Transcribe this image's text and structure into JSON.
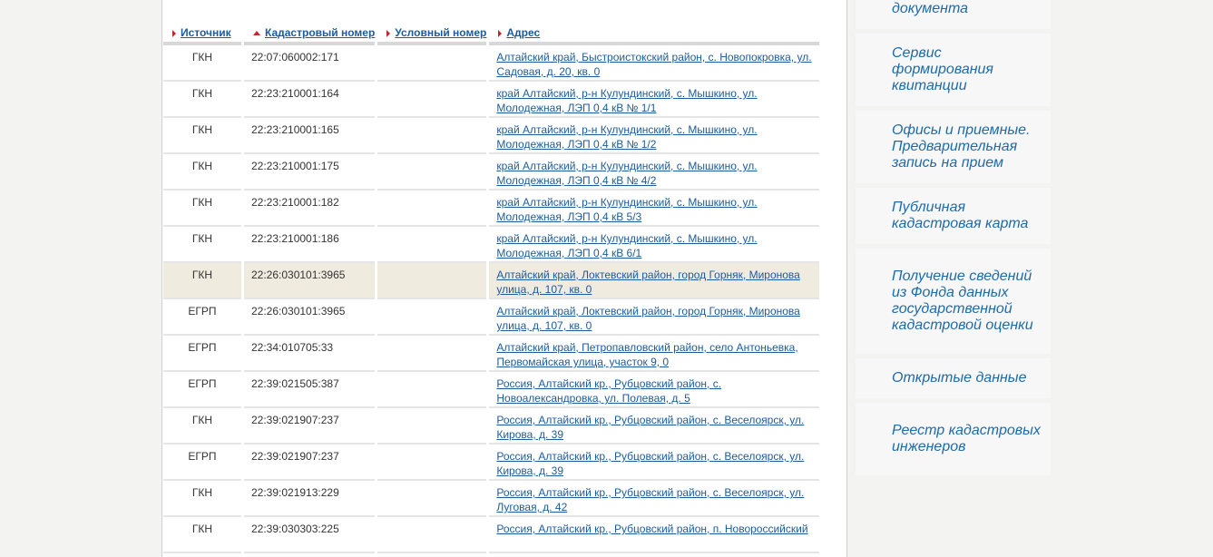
{
  "table": {
    "headers": [
      {
        "label": "Источник",
        "sort": "right"
      },
      {
        "label": "Кадастровый номер",
        "sort": "up"
      },
      {
        "label": "Условный номер",
        "sort": "right"
      },
      {
        "label": "Адрес",
        "sort": "right"
      }
    ],
    "rows": [
      {
        "source": "ГКН",
        "cadastral": "22:07:060002:171",
        "conditional": "",
        "address": "Алтайский край, Быстроистокский район, с. Новопокровка, ул. Садовая, д. 20, кв. 0"
      },
      {
        "source": "ГКН",
        "cadastral": "22:23:210001:164",
        "conditional": "",
        "address": "край Алтайский, р-н Кулундинский, с. Мышкино, ул. Молодежная, ЛЭП 0,4 кВ № 1/1"
      },
      {
        "source": "ГКН",
        "cadastral": "22:23:210001:165",
        "conditional": "",
        "address": "край Алтайский, р-н Кулундинский, с. Мышкино, ул. Молодежная, ЛЭП 0,4 кВ № 1/2"
      },
      {
        "source": "ГКН",
        "cadastral": "22:23:210001:175",
        "conditional": "",
        "address": "край Алтайский, р-н Кулундинский, с. Мышкино, ул. Молодежная, ЛЭП 0,4 кВ № 4/2"
      },
      {
        "source": "ГКН",
        "cadastral": "22:23:210001:182",
        "conditional": "",
        "address": "край Алтайский, р-н Кулундинский, с. Мышкино, ул. Молодежная, ЛЭП 0,4 кВ 5/3"
      },
      {
        "source": "ГКН",
        "cadastral": "22:23:210001:186",
        "conditional": "",
        "address": "край Алтайский, р-н Кулундинский, с. Мышкино, ул. Молодежная, ЛЭП 0,4 кВ 6/1"
      },
      {
        "source": "ГКН",
        "cadastral": "22:26:030101:3965",
        "conditional": "",
        "address": "Алтайский край, Локтевский район, город Горняк, Миронова улица, д. 107, кв. 0",
        "highlighted": true
      },
      {
        "source": "ЕГРП",
        "cadastral": "22:26:030101:3965",
        "conditional": "",
        "address": "Алтайский край, Локтевский район, город Горняк, Миронова улица, д. 107, кв. 0"
      },
      {
        "source": "ЕГРП",
        "cadastral": "22:34:010705:33",
        "conditional": "",
        "address": "Алтайский край, Петропавловский район, село Антоньевка, Первомайская улица, участок 9, 0"
      },
      {
        "source": "ЕГРП",
        "cadastral": "22:39:021505:387",
        "conditional": "",
        "address": "Россия, Алтайский кр., Рубцовский район, с. Новоалександровка, ул. Полевая, д. 5"
      },
      {
        "source": "ГКН",
        "cadastral": "22:39:021907:237",
        "conditional": "",
        "address": "Россия, Алтайский кр., Рубцовский район, с. Веселоярск, ул. Кирова, д. 39"
      },
      {
        "source": "ЕГРП",
        "cadastral": "22:39:021907:237",
        "conditional": "",
        "address": "Россия, Алтайский кр., Рубцовский район, с. Веселоярск, ул. Кирова, д. 39"
      },
      {
        "source": "ГКН",
        "cadastral": "22:39:021913:229",
        "conditional": "",
        "address": "Россия, Алтайский кр., Рубцовский район, с. Веселоярск, ул. Луговая, д. 42"
      },
      {
        "source": "ГКН",
        "cadastral": "22:39:030303:225",
        "conditional": "",
        "address": "Россия, Алтайский кр., Рубцовский район, п. Новороссийский"
      }
    ]
  },
  "sidebar": {
    "items": [
      {
        "label": "документа",
        "partial_top": true
      },
      {
        "label": "Сервис формирования квитанции"
      },
      {
        "label": "Офисы и приемные. Предварительная запись на прием"
      },
      {
        "label": "Публичная кадастровая карта"
      },
      {
        "label": "Получение сведений из Фонда данных государственной кадастровой оценки"
      },
      {
        "label": "Открытые данные"
      },
      {
        "label": "Реестр кадастровых инженеров"
      }
    ]
  },
  "colors": {
    "link": "#1d5b9d",
    "sort_arrow": "#c0272d",
    "highlight_row": "#f0ebdf",
    "sidebar_text": "#1f6aa8"
  },
  "icons": {
    "sort_inactive": "triangle-right",
    "sort_active": "triangle-up"
  }
}
